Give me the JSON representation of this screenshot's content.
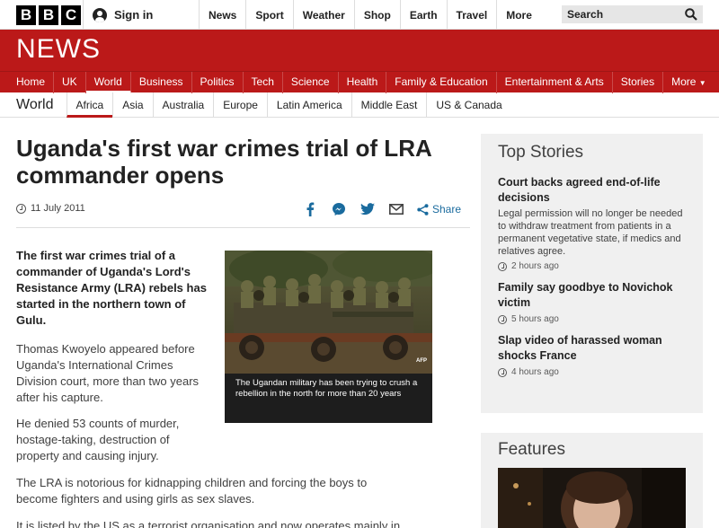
{
  "topbar": {
    "logo_letters": [
      "B",
      "B",
      "C"
    ],
    "signin_label": "Sign in",
    "nav": [
      "News",
      "Sport",
      "Weather",
      "Shop",
      "Earth",
      "Travel"
    ],
    "more_label": "More",
    "search_placeholder": "Search"
  },
  "news": {
    "wordmark": "NEWS",
    "main_nav": [
      "Home",
      "UK",
      "World",
      "Business",
      "Politics",
      "Tech",
      "Science",
      "Health",
      "Family & Education",
      "Entertainment & Arts",
      "Stories",
      "More"
    ]
  },
  "subnav": {
    "section": "World",
    "items": [
      "Africa",
      "Asia",
      "Australia",
      "Europe",
      "Latin America",
      "Middle East",
      "US & Canada"
    ]
  },
  "article": {
    "headline": "Uganda's first war crimes trial of LRA commander opens",
    "date": "11 July 2011",
    "share_label": "Share",
    "lede": "The first war crimes trial of a commander of Uganda's Lord's Resistance Army (LRA) rebels has started in the northern town of Gulu.",
    "paragraphs": [
      "Thomas Kwoyelo appeared before Uganda's International Crimes Division court, more than two years after his capture.",
      "He denied 53 counts of murder, hostage-taking, destruction of property and causing injury.",
      "The LRA is notorious for kidnapping children and forcing the boys to become fighters and using girls as sex slaves.",
      "It is listed by the US as a terrorist organisation and now operates mainly in"
    ],
    "image_caption": "The Ugandan military has been trying to crush a rebellion in the north for more than 20 years",
    "image_credit": "AFP"
  },
  "sidebar": {
    "title": "Top Stories",
    "stories": [
      {
        "headline": "Court backs agreed end-of-life decisions",
        "summary": "Legal permission will no longer be needed to withdraw treatment from patients in a permanent vegetative state, if medics and relatives agree.",
        "time": "2 hours ago"
      },
      {
        "headline": "Family say goodbye to Novichok victim",
        "summary": "",
        "time": "5 hours ago"
      },
      {
        "headline": "Slap video of harassed woman shocks France",
        "summary": "",
        "time": "4 hours ago"
      }
    ]
  },
  "features": {
    "title": "Features"
  },
  "colors": {
    "brand_red": "#bb1919",
    "share_blue": "#1a6b9e"
  }
}
